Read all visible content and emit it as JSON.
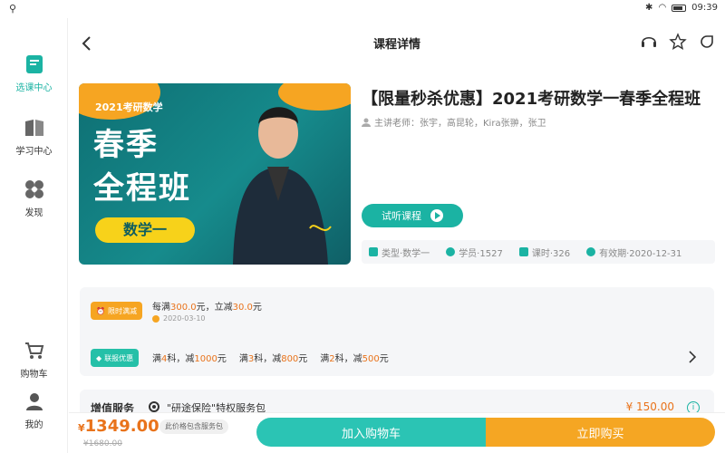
{
  "statusbar": {
    "time": "09:39"
  },
  "sidebar": {
    "items": [
      {
        "label": "选课中心",
        "icon": "book-icon"
      },
      {
        "label": "学习中心",
        "icon": "open-book-icon"
      },
      {
        "label": "发现",
        "icon": "discover-icon"
      },
      {
        "label": "购物车",
        "icon": "cart-icon"
      },
      {
        "label": "我的",
        "icon": "user-icon"
      }
    ]
  },
  "header": {
    "title": "课程详情"
  },
  "cover": {
    "year_text": "2021考研数学",
    "line1": "春季",
    "line2": "全程班",
    "tag": "数学一"
  },
  "course": {
    "title": "【限量秒杀优惠】2021考研数学一春季全程班",
    "teachers": "主讲老师：张宇，高昆轮，Kira张翀，张卫",
    "try_label": "试听课程",
    "meta": {
      "type": "类型·数学一",
      "students": "学员·1527",
      "lessons": "课时·326",
      "valid": "有效期·2020-12-31"
    }
  },
  "promo": {
    "badge1": "限时满减",
    "line1_prefix": "每满",
    "line1_amount1": "300.0",
    "line1_mid": "元，立减",
    "line1_amount2": "30.0",
    "line1_suffix": "元",
    "date": "2020-03-10",
    "badge2": "联报优惠",
    "deals": [
      {
        "pre": "满",
        "n": "4",
        "mid": "科，减",
        "amt": "1000",
        "suf": "元"
      },
      {
        "pre": "满",
        "n": "3",
        "mid": "科，减",
        "amt": "800",
        "suf": "元"
      },
      {
        "pre": "满",
        "n": "2",
        "mid": "科，减",
        "amt": "500",
        "suf": "元"
      }
    ]
  },
  "service": {
    "label": "增值服务",
    "name": "\"研途保险\"特权服务包",
    "price": "¥ 150.00"
  },
  "bottom": {
    "price_yen": "¥",
    "price": "1349.00",
    "old_price": "¥1680.00",
    "package_note": "此价格包含服务包",
    "add_to_cart": "加入购物车",
    "buy_now": "立即购买"
  },
  "colors": {
    "accent": "#1bb3a3",
    "orange": "#f5a623",
    "price": "#e9731b"
  }
}
